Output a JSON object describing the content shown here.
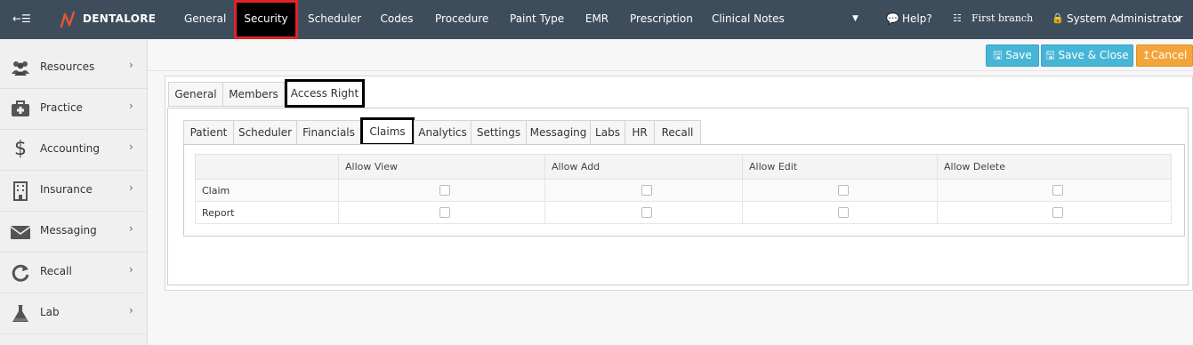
{
  "topbar": {
    "logo_text": "DENTALORE",
    "nav": [
      "General",
      "Security",
      "Scheduler",
      "Codes",
      "Procedure",
      "Paint Type",
      "EMR",
      "Prescription",
      "Clinical Notes"
    ],
    "active_nav": "Security",
    "help_label": "Help?",
    "branch_label": "First branch",
    "user_label": "System Administrator",
    "bg_color": "#3e4d5c"
  },
  "sidebar": {
    "items": [
      {
        "label": "Resources",
        "icon": "users-icon"
      },
      {
        "label": "Practice",
        "icon": "medical-kit-icon"
      },
      {
        "label": "Accounting",
        "icon": "dollar-icon"
      },
      {
        "label": "Insurance",
        "icon": "building-icon"
      },
      {
        "label": "Messaging",
        "icon": "envelope-icon"
      },
      {
        "label": "Recall",
        "icon": "refresh-icon"
      },
      {
        "label": "Lab",
        "icon": "flask-icon"
      }
    ]
  },
  "toolbar": {
    "save_label": "Save",
    "save_close_label": "Save & Close",
    "cancel_label": "Cancel"
  },
  "outer_tabs": [
    "General",
    "Members",
    "Access Right"
  ],
  "outer_active": "Access Right",
  "inner_tabs": [
    "Patient",
    "Scheduler",
    "Financials",
    "Claims",
    "Analytics",
    "Settings",
    "Messaging",
    "Labs",
    "HR",
    "Recall"
  ],
  "inner_active": "Claims",
  "grid": {
    "columns": [
      "",
      "Allow View",
      "Allow Add",
      "Allow Edit",
      "Allow Delete"
    ],
    "rows": [
      {
        "label": "Claim",
        "view": false,
        "add": false,
        "edit": false,
        "delete": false
      },
      {
        "label": "Report",
        "view": false,
        "add": false,
        "edit": false,
        "delete": false
      }
    ]
  }
}
